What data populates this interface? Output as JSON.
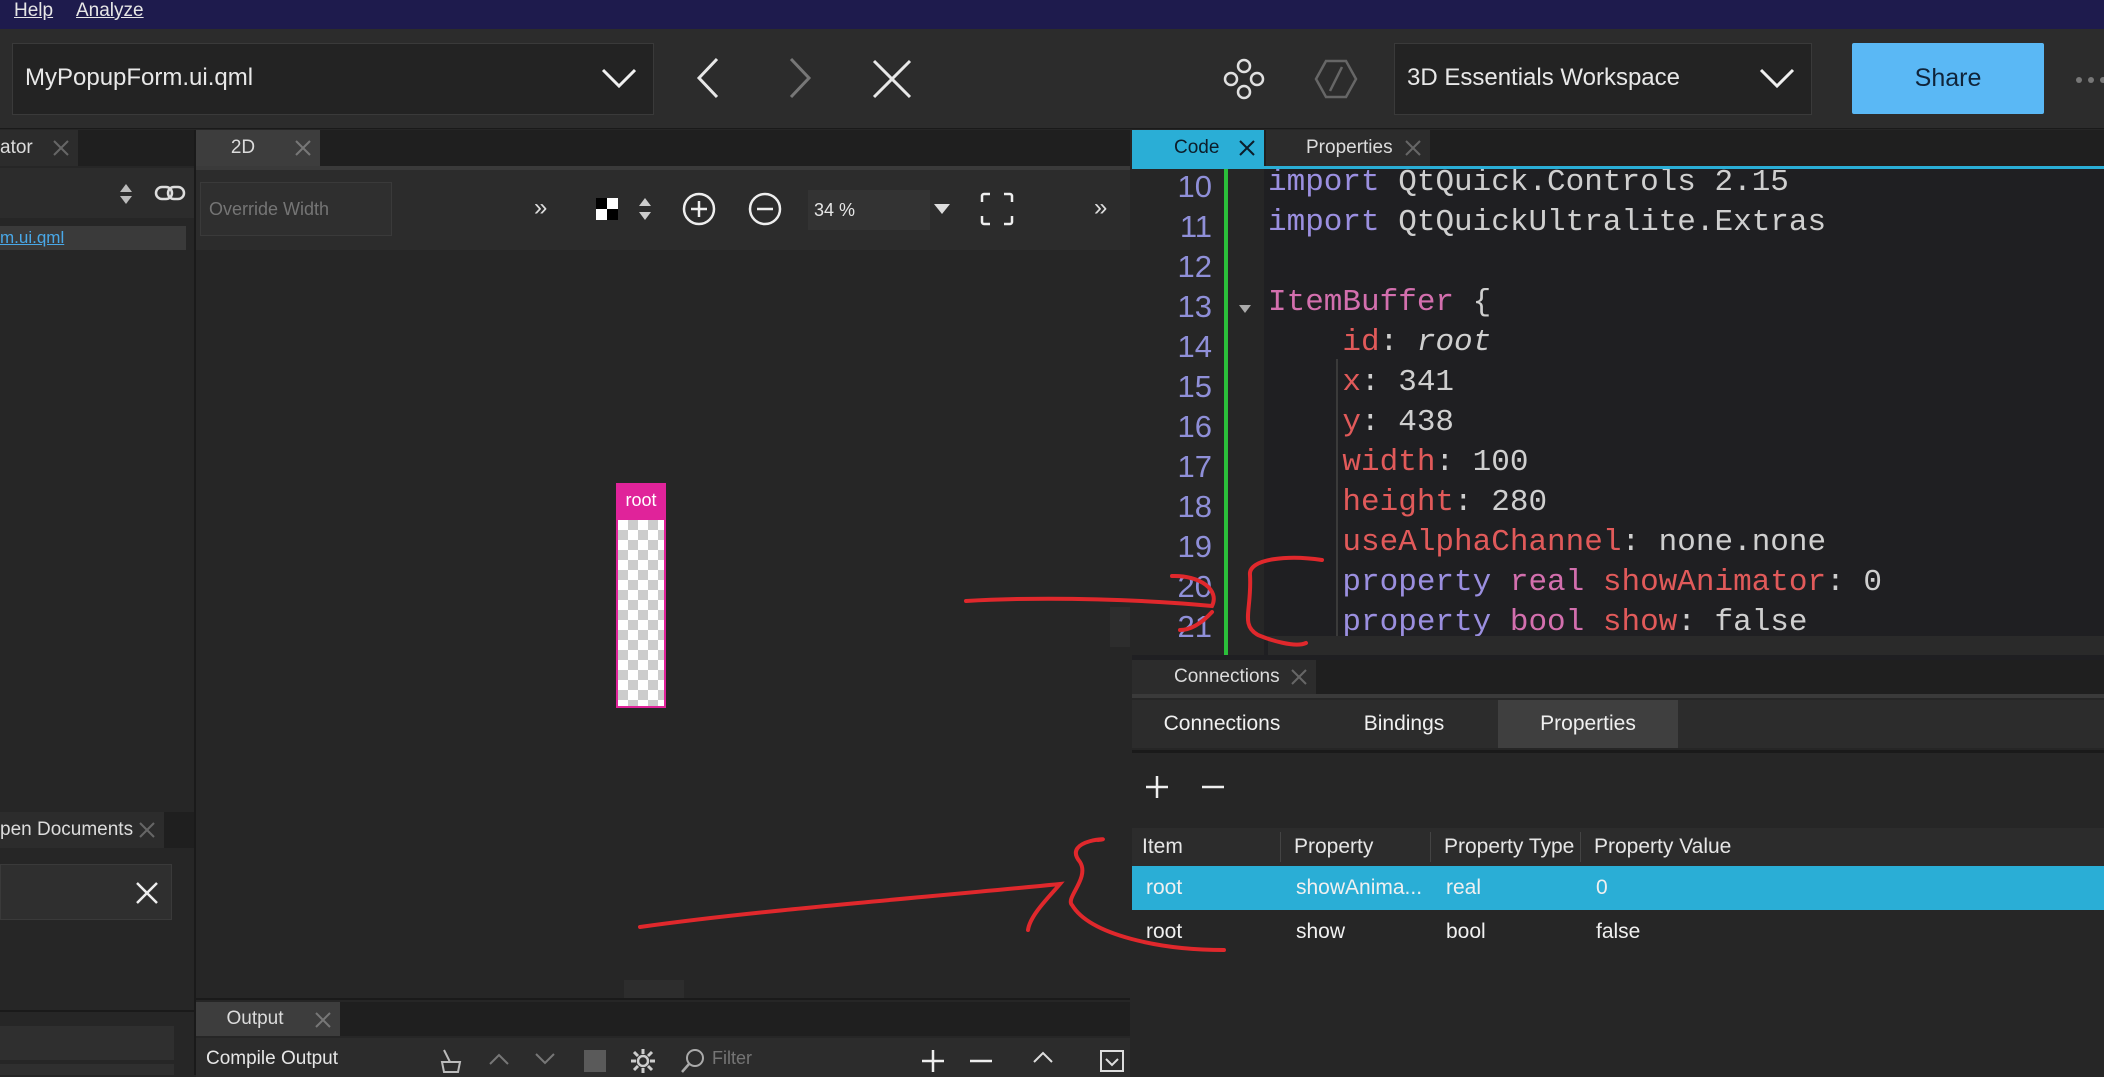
{
  "menu": {
    "help": "Help",
    "analyze": "Analyze"
  },
  "toolbar": {
    "document": "MyPopupForm.ui.qml",
    "workspace": "3D Essentials Workspace",
    "share": "Share"
  },
  "left_panel": {
    "tab": "ator",
    "file_link": "m.ui.qml",
    "open_docs_tab": "pen Documents"
  },
  "center": {
    "tab": "2D",
    "override_width_placeholder": "Override Width",
    "zoom": "34 %",
    "root_label": "root"
  },
  "output": {
    "tab": "Output",
    "compile_output": "Compile Output",
    "filter_placeholder": "Filter"
  },
  "code_panel": {
    "tab_code": "Code",
    "tab_properties": "Properties",
    "line_numbers": [
      "10",
      "11",
      "12",
      "13",
      "14",
      "15",
      "16",
      "17",
      "18",
      "19",
      "20",
      "21"
    ],
    "lines": [
      [
        {
          "t": "import ",
          "c": "kw"
        },
        {
          "t": "QtQuick.Controls 2.15",
          "c": "val"
        }
      ],
      [
        {
          "t": "import ",
          "c": "kw"
        },
        {
          "t": "QtQuickUltralite.Extras",
          "c": "val"
        }
      ],
      [],
      [
        {
          "t": "ItemBuffer ",
          "c": "id"
        },
        {
          "t": "{",
          "c": "val"
        }
      ],
      [
        {
          "t": "    id",
          "c": "prop"
        },
        {
          "t": ": ",
          "c": "val"
        },
        {
          "t": "root",
          "c": "it"
        }
      ],
      [
        {
          "t": "    x",
          "c": "prop"
        },
        {
          "t": ": 341",
          "c": "val"
        }
      ],
      [
        {
          "t": "    y",
          "c": "prop"
        },
        {
          "t": ": 438",
          "c": "val"
        }
      ],
      [
        {
          "t": "    width",
          "c": "prop"
        },
        {
          "t": ": 100",
          "c": "val"
        }
      ],
      [
        {
          "t": "    height",
          "c": "prop"
        },
        {
          "t": ": 280",
          "c": "val"
        }
      ],
      [
        {
          "t": "    useAlphaChannel",
          "c": "prop"
        },
        {
          "t": ": none.none",
          "c": "val"
        }
      ],
      [
        {
          "t": "    property ",
          "c": "kw"
        },
        {
          "t": "real ",
          "c": "id"
        },
        {
          "t": "showAnimator",
          "c": "prop"
        },
        {
          "t": ": 0",
          "c": "val"
        }
      ],
      [
        {
          "t": "    property ",
          "c": "kw"
        },
        {
          "t": "bool ",
          "c": "id"
        },
        {
          "t": "show",
          "c": "prop"
        },
        {
          "t": ": false",
          "c": "val"
        }
      ]
    ]
  },
  "connections_panel": {
    "tab": "Connections",
    "subtabs": [
      "Connections",
      "Bindings",
      "Properties"
    ],
    "active_subtab": "Properties",
    "headers": [
      "Item",
      "Property",
      "Property Type",
      "Property Value"
    ],
    "rows": [
      [
        "root",
        "showAnima...",
        "real",
        "0"
      ],
      [
        "root",
        "show",
        "bool",
        "false"
      ]
    ]
  },
  "colors": {
    "accent": "#2aaed6",
    "share": "#5ab8f5",
    "root_badge": "#e0239a",
    "annotation": "#e0282c"
  }
}
